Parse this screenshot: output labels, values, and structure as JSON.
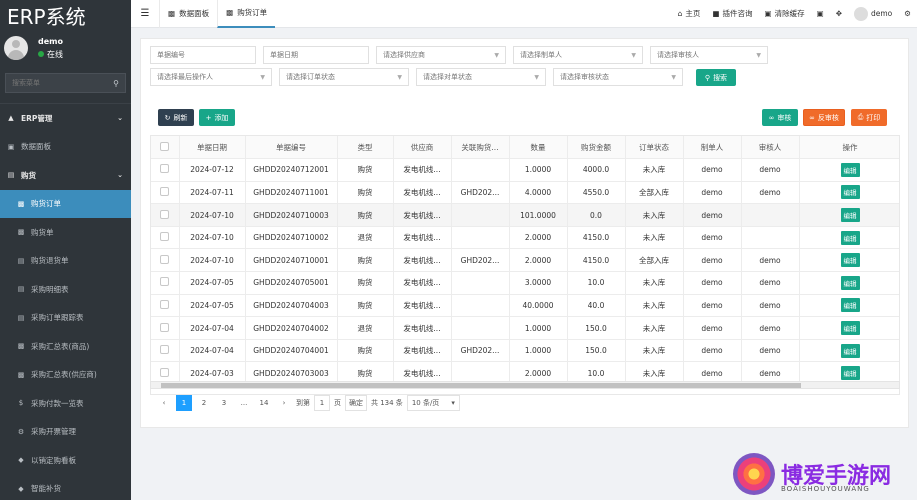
{
  "app": {
    "logo": "ERP系统"
  },
  "user": {
    "name": "demo",
    "status": "在线"
  },
  "sidebar": {
    "search_placeholder": "搜索菜单",
    "items": [
      {
        "label": "ERP管理",
        "icon": "graduation-icon"
      },
      {
        "label": "数据面板",
        "icon": "dashboard-icon"
      },
      {
        "label": "购货",
        "icon": "car-icon"
      },
      {
        "label": "购货订单",
        "icon": "chart-icon"
      },
      {
        "label": "购货单",
        "icon": "chart-icon"
      },
      {
        "label": "购货退货单",
        "icon": "document-icon"
      },
      {
        "label": "采购明细表",
        "icon": "document-icon"
      },
      {
        "label": "采购订单跟踪表",
        "icon": "document-icon"
      },
      {
        "label": "采购汇总表(商品)",
        "icon": "chart-icon"
      },
      {
        "label": "采购汇总表(供应商)",
        "icon": "chart-icon"
      },
      {
        "label": "采购付款一览表",
        "icon": "dollar-icon"
      },
      {
        "label": "采购开票管理",
        "icon": "gear-icon"
      },
      {
        "label": "以销定购看板",
        "icon": "cube-icon"
      },
      {
        "label": "智能补货",
        "icon": "cube-icon"
      }
    ]
  },
  "topbar": {
    "tabs": [
      "数据面板",
      "购货订单"
    ],
    "right": [
      "主页",
      "插件咨询",
      "清除缓存"
    ],
    "user": "demo"
  },
  "filters": {
    "row1": [
      "单据编号",
      "单据日期",
      "请选择供应商",
      "请选择制单人",
      "请选择审核人"
    ],
    "row2": [
      "请选择最后操作人",
      "请选择订单状态",
      "请选择对单状态",
      "请选择审核状态"
    ],
    "search": "搜索"
  },
  "toolbar": {
    "refresh": "刷新",
    "add": "添加",
    "audit": "审核",
    "unaudit": "反审核",
    "print": "打印"
  },
  "table": {
    "headers": [
      "单据日期",
      "单据编号",
      "类型",
      "供应商",
      "关联购货...",
      "数量",
      "购货金额",
      "订单状态",
      "制单人",
      "审核人",
      "操作"
    ],
    "edit_label": "编辑",
    "rows": [
      [
        "2024-07-12",
        "GHDD20240712001",
        "购货",
        "发电机线...",
        "",
        "1.0000",
        "4000.0",
        "未入库",
        "demo",
        "demo"
      ],
      [
        "2024-07-11",
        "GHDD20240711001",
        "购货",
        "发电机线...",
        "GHD202...",
        "4.0000",
        "4550.0",
        "全部入库",
        "demo",
        "demo"
      ],
      [
        "2024-07-10",
        "GHDD20240710003",
        "购货",
        "发电机线...",
        "",
        "101.0000",
        "0.0",
        "未入库",
        "demo",
        ""
      ],
      [
        "2024-07-10",
        "GHDD20240710002",
        "退货",
        "发电机线...",
        "",
        "2.0000",
        "4150.0",
        "未入库",
        "demo",
        ""
      ],
      [
        "2024-07-10",
        "GHDD20240710001",
        "购货",
        "发电机线...",
        "GHD202...",
        "2.0000",
        "4150.0",
        "全部入库",
        "demo",
        "demo"
      ],
      [
        "2024-07-05",
        "GHDD20240705001",
        "购货",
        "发电机线...",
        "",
        "3.0000",
        "10.0",
        "未入库",
        "demo",
        "demo"
      ],
      [
        "2024-07-05",
        "GHDD20240704003",
        "购货",
        "发电机线...",
        "",
        "40.0000",
        "40.0",
        "未入库",
        "demo",
        "demo"
      ],
      [
        "2024-07-04",
        "GHDD20240704002",
        "退货",
        "发电机线...",
        "",
        "1.0000",
        "150.0",
        "未入库",
        "demo",
        "demo"
      ],
      [
        "2024-07-04",
        "GHDD20240704001",
        "购货",
        "发电机线...",
        "GHD202...",
        "1.0000",
        "150.0",
        "未入库",
        "demo",
        "demo"
      ],
      [
        "2024-07-03",
        "GHDD20240703003",
        "购货",
        "发电机线...",
        "",
        "2.0000",
        "10.0",
        "未入库",
        "demo",
        "demo"
      ]
    ]
  },
  "pager": {
    "pages": [
      "1",
      "2",
      "3",
      "...",
      "14"
    ],
    "goto_label": "到第",
    "goto_value": "1",
    "page_unit": "页",
    "confirm": "确定",
    "total": "共 134 条",
    "per_page": "10 条/页"
  },
  "watermark": {
    "text": "博爱手游网",
    "sub": "BOAISHOUYOUWANG"
  }
}
